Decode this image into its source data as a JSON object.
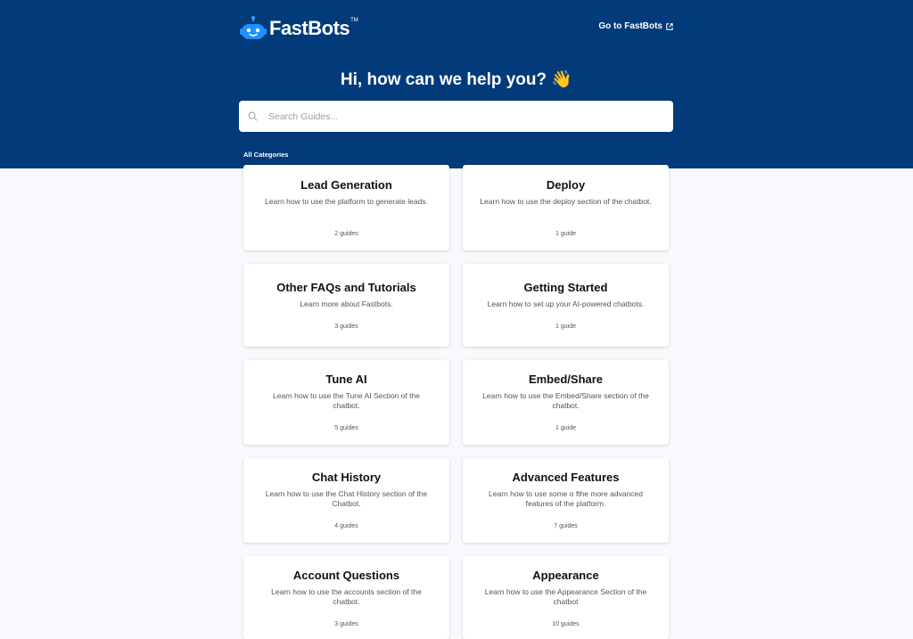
{
  "header": {
    "logo": {
      "text_primary": "Fast",
      "text_secondary": "Bots",
      "tm": "TM"
    },
    "goto_link": "Go to FastBots",
    "headline": "Hi, how can we help you? 👋"
  },
  "search": {
    "placeholder": "Search Guides..."
  },
  "section_label": "All Categories",
  "categories": [
    {
      "title": "Lead Generation",
      "description": "Learn how to use the platform to generate leads.",
      "count": "2 guides"
    },
    {
      "title": "Deploy",
      "description": "Learn how to use the deploy section of the chatbot.",
      "count": "1 guide"
    },
    {
      "title": "Other FAQs and Tutorials",
      "description": "Learn more about Fastbots.",
      "count": "3 guides"
    },
    {
      "title": "Getting Started",
      "description": "Learn how to set up your AI-powered chatbots.",
      "count": "1 guide"
    },
    {
      "title": "Tune AI",
      "description": "Learn how to use the Tune AI Section of the chatbot.",
      "count": "5 guides"
    },
    {
      "title": "Embed/Share",
      "description": "Learn how to use the Embed/Share section of the chatbot.",
      "count": "1 guide"
    },
    {
      "title": "Chat History",
      "description": "Learn how to use the Chat History section of the Chatbot.",
      "count": "4 guides"
    },
    {
      "title": "Advanced Features",
      "description": "Learn how to use some o fthe more advanced features of the platform.",
      "count": "7 guides"
    },
    {
      "title": "Account Questions",
      "description": "Learn how to use the accounts section of the chatbot.",
      "count": "3 guides"
    },
    {
      "title": "Appearance",
      "description": "Learn how to use the Appearance Section of the chatbot",
      "count": "10 guides"
    }
  ],
  "colors": {
    "header_bg": "#023a7a",
    "page_bg": "#f7f9fc",
    "logo_accent": "#1e90ff"
  }
}
